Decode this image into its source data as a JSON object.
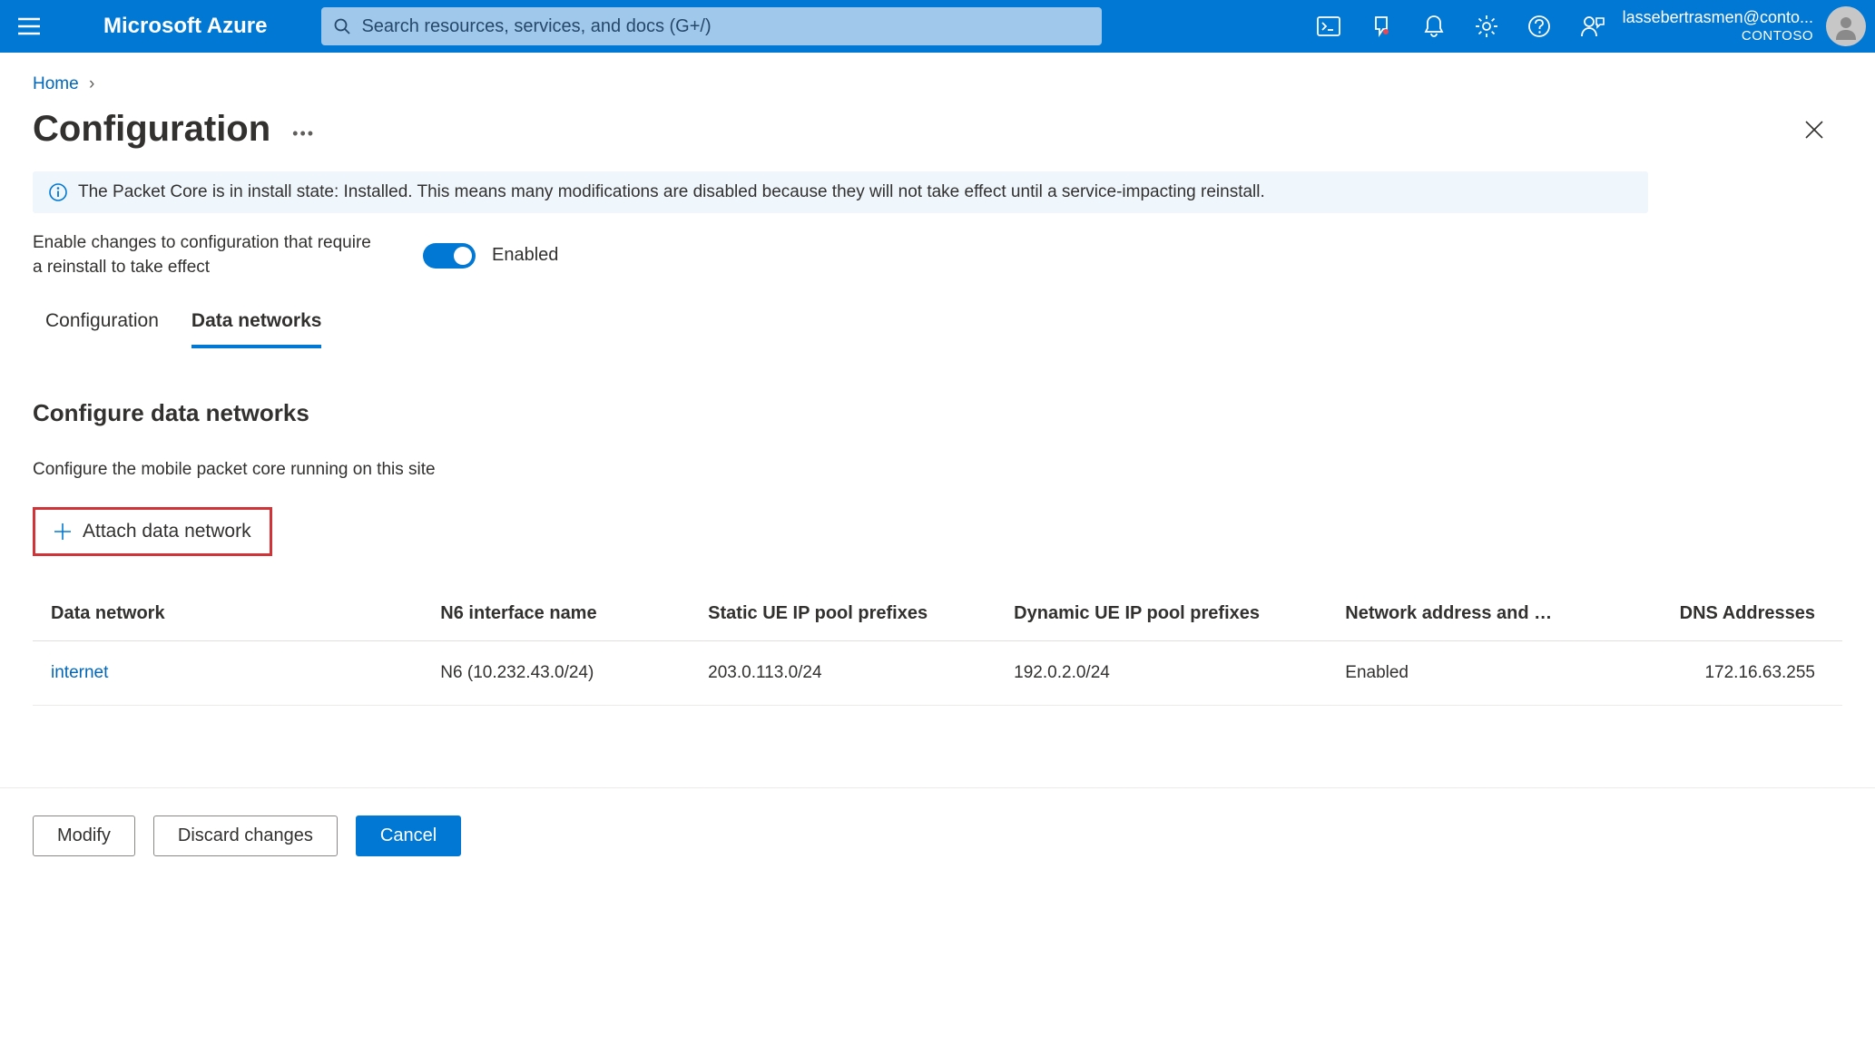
{
  "header": {
    "brand": "Microsoft Azure",
    "search_placeholder": "Search resources, services, and docs (G+/)",
    "account_email": "lassebertrasmen@conto...",
    "tenant": "CONTOSO"
  },
  "breadcrumb": {
    "home": "Home"
  },
  "page": {
    "title": "Configuration"
  },
  "banner": {
    "message": "The Packet Core is in install state: Installed. This means many modifications are disabled because they will not take effect until a service-impacting reinstall."
  },
  "toggle": {
    "label": "Enable changes to configuration that require a reinstall to take effect",
    "state": "Enabled"
  },
  "tabs": {
    "configuration": "Configuration",
    "data_networks": "Data networks"
  },
  "section": {
    "heading": "Configure data networks",
    "description": "Configure the mobile packet core running on this site",
    "attach_label": "Attach data network"
  },
  "table": {
    "headers": {
      "data_network": "Data network",
      "n6": "N6 interface name",
      "static_ue": "Static UE IP pool prefixes",
      "dynamic_ue": "Dynamic UE IP pool prefixes",
      "napt": "Network address and …",
      "dns": "DNS Addresses"
    },
    "row": {
      "data_network": "internet",
      "n6": "N6 (10.232.43.0/24)",
      "static_ue": "203.0.113.0/24",
      "dynamic_ue": "192.0.2.0/24",
      "napt": "Enabled",
      "dns": "172.16.63.255"
    }
  },
  "footer": {
    "modify": "Modify",
    "discard": "Discard changes",
    "cancel": "Cancel"
  }
}
